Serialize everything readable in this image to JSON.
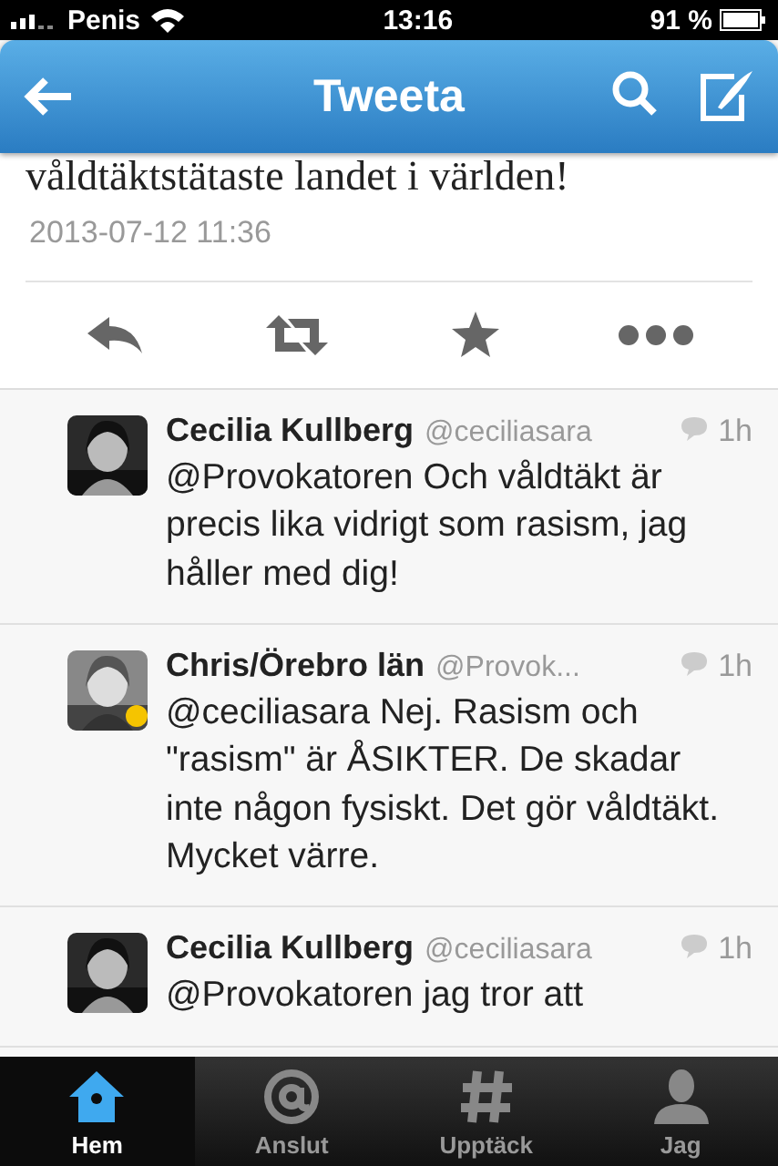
{
  "status_bar": {
    "carrier": "Penis",
    "time": "13:16",
    "battery": "91 %"
  },
  "nav_bar": {
    "title": "Tweeta"
  },
  "tweet": {
    "text_tail": "våldtäktstätaste landet i världen!",
    "timestamp": "2013-07-12 11:36"
  },
  "replies": [
    {
      "name": "Cecilia Kullberg",
      "handle": "@ceciliasara",
      "time": "1h",
      "text": "@Provokatoren Och våldtäkt är precis lika vidrigt som rasism, jag håller med dig!"
    },
    {
      "name": "Chris/Örebro län",
      "handle": "@Provok...",
      "time": "1h",
      "text": "@ceciliasara Nej. Rasism och \"rasism\" är ÅSIKTER. De skadar inte någon fysiskt. Det gör våldtäkt. Mycket värre."
    },
    {
      "name": "Cecilia Kullberg",
      "handle": "@ceciliasara",
      "time": "1h",
      "text": "@Provokatoren jag tror att"
    }
  ],
  "tab_bar": [
    {
      "label": "Hem",
      "kind": "home",
      "selected": true
    },
    {
      "label": "Anslut",
      "kind": "at",
      "selected": false
    },
    {
      "label": "Upptäck",
      "kind": "hash",
      "selected": false
    },
    {
      "label": "Jag",
      "kind": "person",
      "selected": false
    }
  ]
}
